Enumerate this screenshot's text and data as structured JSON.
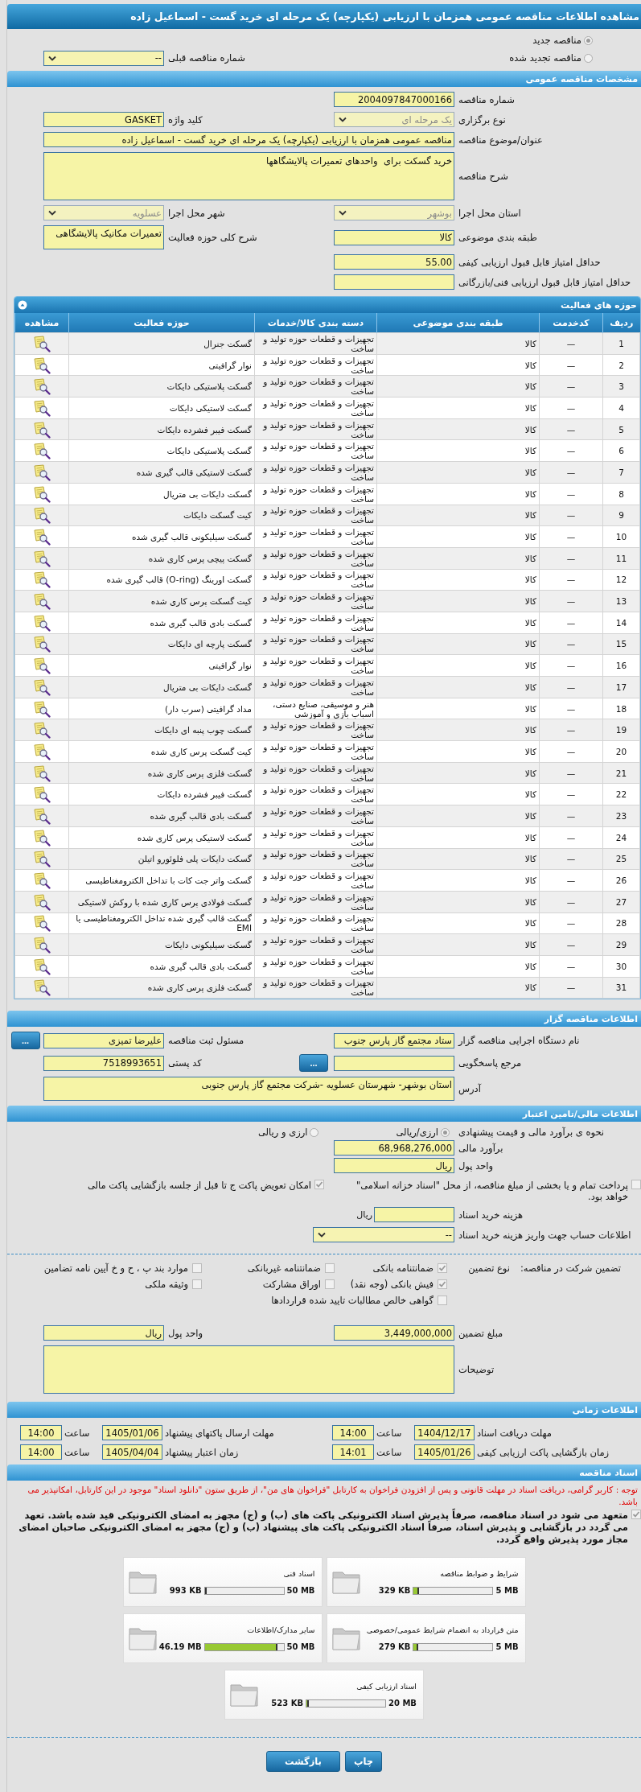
{
  "window": {
    "title": "مشاهده اطلاعات مناقصه عمومی همزمان با ارزیابی (یکپارچه) یک مرحله ای خرید گست - اسماعیل زاده"
  },
  "tender_kind": [
    {
      "label": "مناقصه جدید",
      "selected": true
    },
    {
      "label": "مناقصه تجدید شده",
      "selected": false
    }
  ],
  "previous_tender": {
    "label": "شماره مناقصه قبلی",
    "value": "--",
    "kind": "select",
    "disabled": false
  },
  "general": {
    "title": "مشخصات مناقصه عمومی",
    "rows": [
      [
        {
          "label": "شماره مناقصه",
          "value": "2004097847000166",
          "kind": "input"
        }
      ],
      [
        {
          "label": "نوع برگزاری",
          "value": "یک مرحله ای",
          "kind": "select",
          "disabled": true
        },
        {
          "label": "کلید واژه",
          "value": "GASKET",
          "kind": "input"
        }
      ],
      [
        {
          "label": "عنوان/موضوع مناقصه",
          "value": "مناقصه عمومی همزمان با ارزیابی (یکپارچه) یک مرحله ای خرید گست - اسماعیل زاده",
          "kind": "long-input"
        }
      ],
      [
        {
          "label": "شرح مناقصه",
          "value": "خرید گسکت برای  واحدهای تعمیرات پالایشگاهها",
          "kind": "memo"
        }
      ],
      [
        {
          "label": "استان محل اجرا",
          "value": "بوشهر",
          "kind": "select",
          "disabled": true
        },
        {
          "label": "شهر محل اجرا",
          "value": "عسلویه",
          "kind": "select",
          "disabled": true
        }
      ],
      [
        {
          "label": "طبقه بندی موضوعی",
          "value": "کالا",
          "kind": "input"
        },
        {
          "label": "شرح کلی حوزه فعالیت",
          "value": "تعمیرات مکانیک پالایشگاهی",
          "kind": "small-memo"
        }
      ],
      [
        {
          "label": "حداقل امتیاز قابل قبول ارزیابی کیفی",
          "value": "55.00",
          "kind": "input"
        }
      ],
      [
        {
          "label": "حداقل امتیاز قابل قبول ارزیابی فنی/بازرگانی",
          "kind": "input"
        }
      ]
    ]
  },
  "activities": {
    "title": "حوزه های فعالیت",
    "columns": [
      "ردیف",
      "کدخدمت",
      "طبقه بندی موضوعی",
      "دسته بندی کالا/خدمات",
      "حوزه فعالیت",
      "مشاهده"
    ],
    "rows": [
      {
        "index": "1",
        "code": "—",
        "subject": "کالا",
        "category": "تجهیزات و قطعات حوزه تولید و ساخت",
        "field": "گسکت جنرال"
      },
      {
        "index": "2",
        "code": "—",
        "subject": "کالا",
        "category": "تجهیزات و قطعات حوزه تولید و ساخت",
        "field": "نوار گرافیتی"
      },
      {
        "index": "3",
        "code": "—",
        "subject": "کالا",
        "category": "تجهیزات و قطعات حوزه تولید و ساخت",
        "field": "گسکت پلاستیکی دایکات"
      },
      {
        "index": "4",
        "code": "—",
        "subject": "کالا",
        "category": "تجهیزات و قطعات حوزه تولید و ساخت",
        "field": "گسکت لاستیکی دایکات"
      },
      {
        "index": "5",
        "code": "—",
        "subject": "کالا",
        "category": "تجهیزات و قطعات حوزه تولید و ساخت",
        "field": "گسکت فیبر فشرده دایکات"
      },
      {
        "index": "6",
        "code": "—",
        "subject": "کالا",
        "category": "تجهیزات و قطعات حوزه تولید و ساخت",
        "field": "گسکت پلاستیکی دایکات"
      },
      {
        "index": "7",
        "code": "—",
        "subject": "کالا",
        "category": "تجهیزات و قطعات حوزه تولید و ساخت",
        "field": "گسکت لاستیکی قالب گیری شده"
      },
      {
        "index": "8",
        "code": "—",
        "subject": "کالا",
        "category": "تجهیزات و قطعات حوزه تولید و ساخت",
        "field": "گسکت دایکات بی متریال"
      },
      {
        "index": "9",
        "code": "—",
        "subject": "کالا",
        "category": "تجهیزات و قطعات حوزه تولید و ساخت",
        "field": "کیت گسکت دایکات"
      },
      {
        "index": "10",
        "code": "—",
        "subject": "کالا",
        "category": "تجهیزات و قطعات حوزه تولید و ساخت",
        "field": "گسکت سیلیکونی قالب گیری شده"
      },
      {
        "index": "11",
        "code": "—",
        "subject": "کالا",
        "category": "تجهیزات و قطعات حوزه تولید و ساخت",
        "field": "گسکت پیچی پرس کاری شده"
      },
      {
        "index": "12",
        "code": "—",
        "subject": "کالا",
        "category": "تجهیزات و قطعات حوزه تولید و ساخت",
        "field": "گسکت اورینگ (O-ring) قالب گیری شده"
      },
      {
        "index": "13",
        "code": "—",
        "subject": "کالا",
        "category": "تجهیزات و قطعات حوزه تولید و ساخت",
        "field": "کیت گسکت پرس کاری شده"
      },
      {
        "index": "14",
        "code": "—",
        "subject": "کالا",
        "category": "تجهیزات و قطعات حوزه تولید و ساخت",
        "field": "گسکت بادی قالب گیری شده"
      },
      {
        "index": "15",
        "code": "—",
        "subject": "کالا",
        "category": "تجهیزات و قطعات حوزه تولید و ساخت",
        "field": "گسکت پارچه ای دایکات"
      },
      {
        "index": "16",
        "code": "—",
        "subject": "کالا",
        "category": "تجهیزات و قطعات حوزه تولید و ساخت",
        "field": "نوار گرافیتی"
      },
      {
        "index": "17",
        "code": "—",
        "subject": "کالا",
        "category": "تجهیزات و قطعات حوزه تولید و ساخت",
        "field": "گسکت دایکات بی متریال"
      },
      {
        "index": "18",
        "code": "—",
        "subject": "کالا",
        "category": "هنر و موسیقی، صنایع دستی، اسباب بازی و آموزشی",
        "field": "مداد گرافیتی (سرب دار)"
      },
      {
        "index": "19",
        "code": "—",
        "subject": "کالا",
        "category": "تجهیزات و قطعات حوزه تولید و ساخت",
        "field": "گسکت چوب پنبه ای دایکات"
      },
      {
        "index": "20",
        "code": "—",
        "subject": "کالا",
        "category": "تجهیزات و قطعات حوزه تولید و ساخت",
        "field": "کیت گسکت پرس کاری شده"
      },
      {
        "index": "21",
        "code": "—",
        "subject": "کالا",
        "category": "تجهیزات و قطعات حوزه تولید و ساخت",
        "field": "گسکت فلزی پرس کاری شده"
      },
      {
        "index": "22",
        "code": "—",
        "subject": "کالا",
        "category": "تجهیزات و قطعات حوزه تولید و ساخت",
        "field": "گسکت فیبر فشرده دایکات"
      },
      {
        "index": "23",
        "code": "—",
        "subject": "کالا",
        "category": "تجهیزات و قطعات حوزه تولید و ساخت",
        "field": "گسکت بادی قالب گیری شده"
      },
      {
        "index": "24",
        "code": "—",
        "subject": "کالا",
        "category": "تجهیزات و قطعات حوزه تولید و ساخت",
        "field": "گسکت لاستیکی پرس کاری شده"
      },
      {
        "index": "25",
        "code": "—",
        "subject": "کالا",
        "category": "تجهیزات و قطعات حوزه تولید و ساخت",
        "field": "گسکت دایکات پلی فلوئورو اتیلن"
      },
      {
        "index": "26",
        "code": "—",
        "subject": "کالا",
        "category": "تجهیزات و قطعات حوزه تولید و ساخت",
        "field": "گسکت واتر جت کات با تداخل الکترومغناطیسی"
      },
      {
        "index": "27",
        "code": "—",
        "subject": "کالا",
        "category": "تجهیزات و قطعات حوزه تولید و ساخت",
        "field": "گسکت فولادی پرس کاری شده با روکش لاستیکی"
      },
      {
        "index": "28",
        "code": "—",
        "subject": "کالا",
        "category": "تجهیزات و قطعات حوزه تولید و ساخت",
        "field": "گسکت قالب گیری شده تداخل الکترومغناطیسی یا EMI"
      },
      {
        "index": "29",
        "code": "—",
        "subject": "کالا",
        "category": "تجهیزات و قطعات حوزه تولید و ساخت",
        "field": "گسکت سیلیکونی دایکات"
      },
      {
        "index": "30",
        "code": "—",
        "subject": "کالا",
        "category": "تجهیزات و قطعات حوزه تولید و ساخت",
        "field": "گسکت بادی قالب گیری شده"
      },
      {
        "index": "31",
        "code": "—",
        "subject": "کالا",
        "category": "تجهیزات و قطعات حوزه تولید و ساخت",
        "field": "گسکت فلزی پرس کاری شده"
      }
    ]
  },
  "organizer": {
    "title": "اطلاعات مناقصه گزار",
    "rows": [
      [
        {
          "label": "نام دستگاه اجرایی مناقصه گزار",
          "value": "ستاد مجتمع گاز پارس جنوب",
          "kind": "input"
        },
        {
          "label": "مسئول ثبت مناقصه",
          "value": "علیرضا تمیزی",
          "kind": "input",
          "button": "..."
        }
      ],
      [
        {
          "label": "مرجع پاسخگویی",
          "kind": "input",
          "button": "..."
        },
        {
          "label": "کد پستی",
          "value": "7518993651",
          "kind": "input"
        }
      ],
      [
        {
          "label": "آدرس",
          "value": "استان بوشهر- شهرستان عسلویه -شرکت مجتمع گاز پارس جنوبی",
          "kind": "long-memo"
        }
      ]
    ]
  },
  "finance": {
    "title": "اطلاعات مالی/تامین اعتبار",
    "pricing": {
      "label": "نحوه ی برآورد مالی و قیمت پیشنهادی",
      "options": [
        {
          "label": "ارزی/ریالی",
          "selected": true
        },
        {
          "label": "ارزی و ریالی",
          "selected": false
        }
      ]
    },
    "fields": [
      {
        "label": "برآورد مالی",
        "value": "68,968,276,000",
        "kind": "input"
      },
      {
        "label": "واحد پول",
        "value": "ریال",
        "kind": "input"
      }
    ],
    "treasury": {
      "label": "پرداخت تمام و یا بخشی از مبلغ مناقصه، از محل \"اسناد خزانه اسلامی\" خواهد بود.",
      "checked": false
    },
    "swap": {
      "label": "امکان تعویض پاکت ج تا قبل از جلسه بازگشایی پاکت مالی",
      "checked": true
    },
    "doc_fee": {
      "label": "هزینه خرید اسناد",
      "unit": "ریال"
    },
    "account": {
      "label": "اطلاعات حساب جهت واریز هزینه خرید اسناد",
      "value": "--"
    }
  },
  "guarantee": {
    "label": "تضمین شرکت در مناقصه:",
    "type_label": "نوع تضمین",
    "options": [
      {
        "label": "ضمانتنامه بانکی",
        "checked": true
      },
      {
        "label": "ضمانتنامه غیربانکی",
        "checked": false
      },
      {
        "label": "موارد بند پ ، ح و خ آیین نامه تضامین",
        "checked": false
      },
      {
        "label": "فیش بانکی (وجه نقد)",
        "checked": true
      },
      {
        "label": "اوراق مشارکت",
        "checked": false
      },
      {
        "label": "وثیقه ملکی",
        "checked": false
      },
      {
        "label": "گواهی خالص مطالبات تایید شده قراردادها",
        "checked": false
      }
    ],
    "rows": [
      [
        {
          "label": "مبلغ تضمین",
          "value": "3,449,000,000",
          "kind": "input"
        },
        {
          "label": "واحد پول",
          "value": "ریال",
          "kind": "input"
        }
      ],
      [
        {
          "label": "توضیحات",
          "kind": "memo"
        }
      ]
    ]
  },
  "timing": {
    "title": "اطلاعات زمانی",
    "rows": [
      [
        {
          "label": "مهلت دریافت اسناد",
          "date": "1404/12/17",
          "time_label": "ساعت",
          "time": "14:00"
        },
        {
          "label": "مهلت ارسال پاکتهای پیشنهاد",
          "date": "1405/01/06",
          "time_label": "ساعت",
          "time": "14:00"
        }
      ],
      [
        {
          "label": "زمان بازگشایی پاکت ارزیابی کیفی",
          "date": "1405/01/26",
          "time_label": "ساعت",
          "time": "14:01"
        },
        {
          "label": "زمان اعتبار پیشنهاد",
          "date": "1405/04/04",
          "time_label": "ساعت",
          "time": "14:00"
        }
      ]
    ]
  },
  "documents": {
    "title": "اسناد مناقصه",
    "notice": "توجه : کاربر گرامی، دریافت اسناد در مهلت قانونی و پس از افزودن فراخوان به کارتابل \"فراخوان های من\"، از طریق ستون \"دانلود اسناد\" موجود در این کارتابل، امکانپذیر می باشد.",
    "commitment": {
      "text": "متعهد می شود در اسناد مناقصه، صرفاً پذیرش اسناد الکترونیکی پاکت های (ب) و (ج) مجهز به امضای الکترونیکی قید شده باشد. تعهد می گردد در بازگشایی و پذیرش اسناد، صرفاً اسناد الکترونیکی پاکت های پیشنهاد (ب) و (ج) مجهز به امضای الکترونیکی صاحبان امضای مجاز مورد پذیرش واقع گردد.",
      "checked": true
    },
    "files": [
      {
        "name": "شرایط و ضوابط مناقصه",
        "size": "329 KB",
        "limit": "5 MB",
        "level": 0.064
      },
      {
        "name": "اسناد فنی",
        "size": "993 KB",
        "limit": "50 MB",
        "level": 0.02
      },
      {
        "name": "متن قرارداد به انضمام شرایط عمومی/خصوصی",
        "size": "279 KB",
        "limit": "5 MB",
        "level": 0.055
      },
      {
        "name": "سایر مدارک/اطلاعات",
        "size": "46.19 MB",
        "limit": "50 MB",
        "level": 0.92
      },
      {
        "name": "اسناد ارزیابی کیفی",
        "size": "523 KB",
        "limit": "20 MB",
        "level": 0.026
      }
    ]
  },
  "actions": [
    {
      "label": "چاپ"
    },
    {
      "label": "بازگشت"
    }
  ]
}
